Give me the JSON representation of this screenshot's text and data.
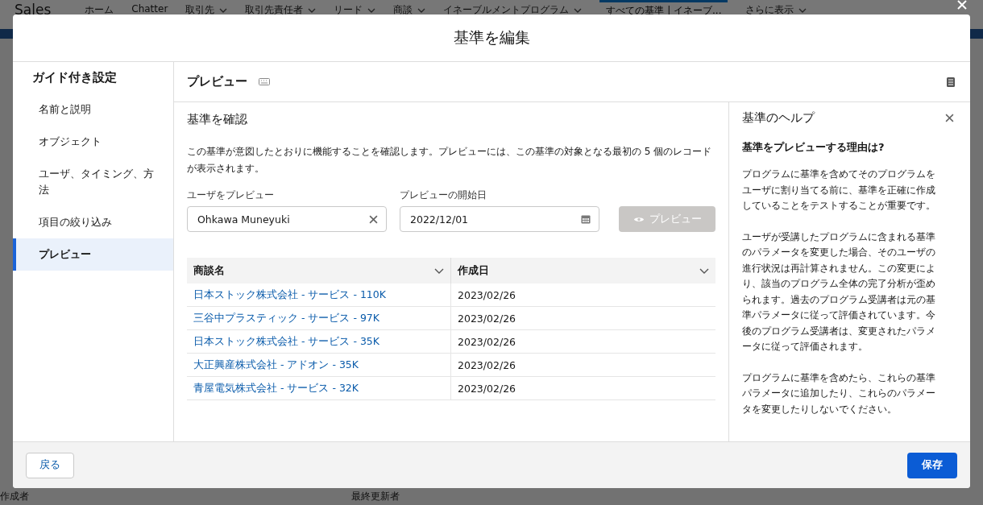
{
  "background": {
    "app_name": "Sales",
    "nav": [
      {
        "label": "ホーム",
        "dropdown": false,
        "selected": false
      },
      {
        "label": "Chatter",
        "dropdown": false,
        "selected": false
      },
      {
        "label": "取引先",
        "dropdown": true,
        "selected": false
      },
      {
        "label": "取引先責任者",
        "dropdown": true,
        "selected": false
      },
      {
        "label": "リード",
        "dropdown": true,
        "selected": false
      },
      {
        "label": "商談",
        "dropdown": true,
        "selected": false
      },
      {
        "label": "イネーブルメントプログラム",
        "dropdown": true,
        "selected": false
      },
      {
        "label": "すべての基準 | イネーブ...",
        "dropdown": false,
        "selected": true
      },
      {
        "label": "さらに表示",
        "dropdown": true,
        "selected": false
      }
    ],
    "footer_labels": [
      "作成者",
      "最終更新者"
    ]
  },
  "modal": {
    "title": "基準を編集",
    "sidebar": {
      "title": "ガイド付き設定",
      "items": [
        {
          "label": "名前と説明",
          "selected": false
        },
        {
          "label": "オブジェクト",
          "selected": false
        },
        {
          "label": "ユーザ、タイミング、方法",
          "selected": false
        },
        {
          "label": "項目の絞り込み",
          "selected": false
        },
        {
          "label": "プレビュー",
          "selected": true
        }
      ]
    },
    "step_title": "プレビュー",
    "section_title": "基準を確認",
    "description": "この基準が意図したとおりに機能することを確認します。プレビューには、この基準の対象となる最初の 5 個のレコードが表示されます。",
    "user_field": {
      "label": "ユーザをプレビュー",
      "value": "Ohkawa Muneyuki"
    },
    "date_field": {
      "label": "プレビューの開始日",
      "value": "2022/12/01"
    },
    "preview_button": {
      "label": "プレビュー",
      "disabled": true
    },
    "table": {
      "columns": [
        "商談名",
        "作成日"
      ],
      "rows": [
        {
          "name": "日本ストック株式会社 - サービス - 110K",
          "date": "2023/02/26"
        },
        {
          "name": "三谷中プラスティック - サービス - 97K",
          "date": "2023/02/26"
        },
        {
          "name": "日本ストック株式会社 - サービス - 35K",
          "date": "2023/02/26"
        },
        {
          "name": "大正興産株式会社 - アドオン - 35K",
          "date": "2023/02/26"
        },
        {
          "name": "青屋電気株式会社 - サービス - 32K",
          "date": "2023/02/26"
        }
      ]
    },
    "help": {
      "title": "基準のヘルプ",
      "heading": "基準をプレビューする理由は?",
      "paragraphs": [
        "プログラムに基準を含めてそのプログラムをユーザに割り当てる前に、基準を正確に作成していることをテストすることが重要です。",
        "ユーザが受講したプログラムに含まれる基準のパラメータを変更した場合、そのユーザの進行状況は再計算されません。この変更により、該当のプログラム全体の完了分析が歪められます。過去のプログラム受講者は元の基準パラメータに従って評価されています。今後のプログラム受講者は、変更されたパラメータに従って評価されます。",
        "プログラムに基準を含めたら、これらの基準パラメータに追加したり、これらのパラメータを変更したりしないでください。"
      ]
    },
    "back_button": "戻る",
    "save_button": "保存"
  }
}
